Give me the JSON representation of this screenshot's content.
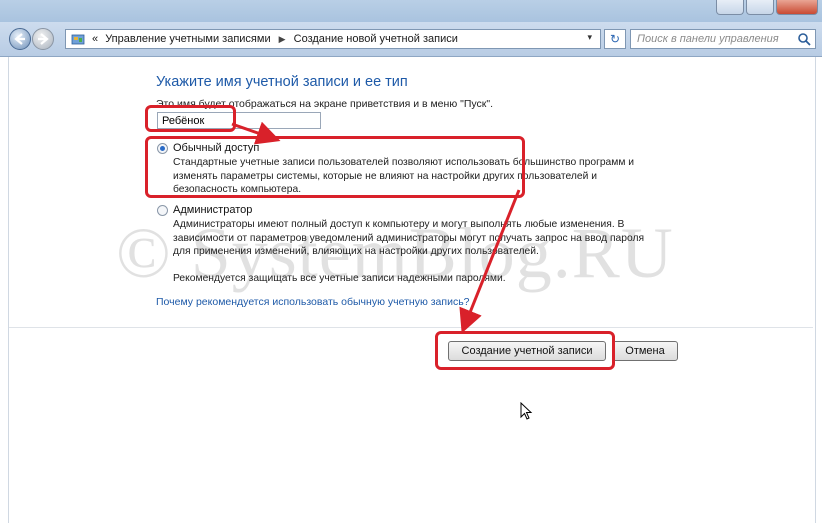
{
  "window": {
    "address_bar": {
      "back_symbol": "«",
      "crumbs": [
        "Управление учетными записями",
        "Создание новой учетной записи"
      ],
      "dropdown_symbol": "▾"
    },
    "refresh_symbol": "↻",
    "search": {
      "placeholder": "Поиск в панели управления"
    }
  },
  "form": {
    "heading": "Укажите имя учетной записи и ее тип",
    "description": "Это имя будет отображаться на экране приветствия и в меню \"Пуск\".",
    "account_name_value": "Ребёнок",
    "options": [
      {
        "label": "Обычный доступ",
        "selected": true,
        "description_lines": [
          "Стандартные учетные записи пользователей позволяют использовать большинство программ и",
          "изменять параметры системы, которые не влияют на настройки других пользователей и",
          "безопасность компьютера."
        ]
      },
      {
        "label": "Администратор",
        "selected": false,
        "description_lines": [
          "Администраторы имеют полный доступ к компьютеру и могут выполнять любые изменения. В",
          "зависимости от параметров уведомлений администраторы могут получать запрос на ввод пароля",
          "для применения изменений, влияющих на настройки других пользователей."
        ],
        "recommendation": "Рекомендуется защищать все учетные записи надежными паролями."
      }
    ],
    "help_link": "Почему рекомендуется использовать обычную учетную запись?"
  },
  "buttons": {
    "create": "Создание учетной записи",
    "cancel": "Отмена"
  },
  "watermark": "© SystemBlog.RU",
  "colors": {
    "highlight": "#d9212a",
    "heading": "#1e5aa8",
    "link": "#1e5aa8"
  }
}
